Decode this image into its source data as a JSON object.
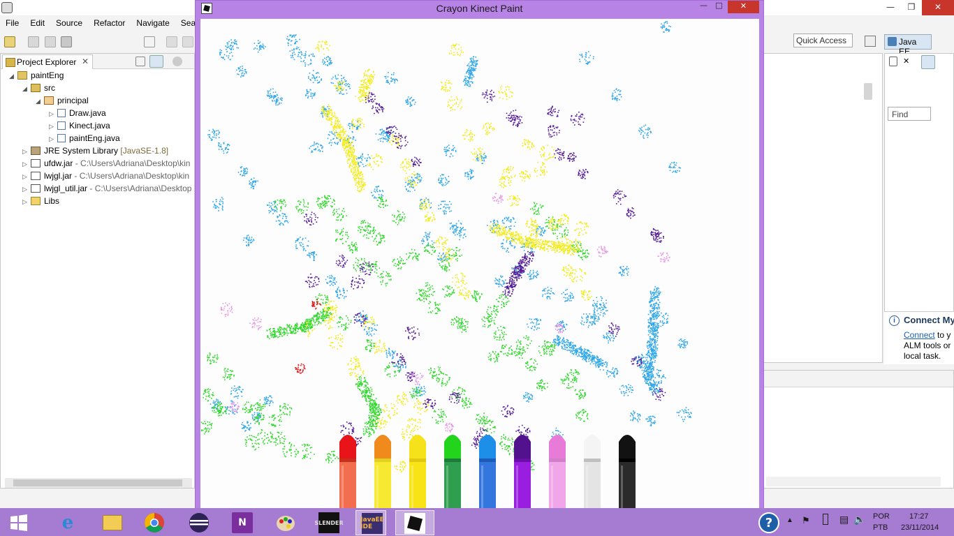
{
  "eclipse": {
    "menu": [
      "File",
      "Edit",
      "Source",
      "Refactor",
      "Navigate",
      "Search"
    ],
    "quick_access": "Quick Access",
    "perspective": "Java EE",
    "project_explorer": {
      "tab_label": "Project Explorer",
      "tab_close": "✕",
      "tree": [
        {
          "twisty": "◢",
          "icon": "proj",
          "label": "paintEng",
          "extra": ""
        },
        {
          "twisty": "◢",
          "icon": "pkgf",
          "label": "src",
          "extra": ""
        },
        {
          "twisty": "◢",
          "icon": "pkg",
          "label": "principal",
          "extra": ""
        },
        {
          "twisty": "▷",
          "icon": "java",
          "label": "Draw.java",
          "extra": ""
        },
        {
          "twisty": "▷",
          "icon": "java",
          "label": "Kinect.java",
          "extra": ""
        },
        {
          "twisty": "▷",
          "icon": "java",
          "label": "paintEng.java",
          "extra": ""
        },
        {
          "twisty": "▷",
          "icon": "lib",
          "label": "JRE System Library",
          "extra": "[JavaSE-1.8]"
        },
        {
          "twisty": "▷",
          "icon": "jar",
          "label": "ufdw.jar",
          "extra": "- C:\\Users\\Adriana\\Desktop\\kin"
        },
        {
          "twisty": "▷",
          "icon": "jar",
          "label": "lwjgl.jar",
          "extra": "- C:\\Users\\Adriana\\Desktop\\kin"
        },
        {
          "twisty": "▷",
          "icon": "jar",
          "label": "lwjgl_util.jar",
          "extra": "- C:\\Users\\Adriana\\Desktop"
        },
        {
          "twisty": "▷",
          "icon": "fold",
          "label": "Libs",
          "extra": ""
        }
      ]
    },
    "outline": {
      "find_placeholder": "Find"
    },
    "connect": {
      "title": "Connect My",
      "link": "Connect",
      "line1_rest": " to y",
      "line2": "ALM tools or",
      "line3": "local task."
    }
  },
  "paint": {
    "title": "Crayon Kinect Paint",
    "crayons": [
      {
        "name": "red",
        "tip": "#e8141a",
        "body": "#f26e4e",
        "band": "#c8301e"
      },
      {
        "name": "orange",
        "tip": "#f08a1c",
        "body": "#f7e832",
        "band": "#e0d020"
      },
      {
        "name": "yellow",
        "tip": "#f5e21a",
        "body": "#f7e316",
        "band": "#e0c810"
      },
      {
        "name": "green",
        "tip": "#22d41c",
        "body": "#2f9e4e",
        "band": "#1e7a3a"
      },
      {
        "name": "blue",
        "tip": "#1e8fe8",
        "body": "#3276de",
        "band": "#1e5ab8"
      },
      {
        "name": "purple",
        "tip": "#52128e",
        "body": "#9a1ee0",
        "band": "#6a10a8"
      },
      {
        "name": "pink",
        "tip": "#e87ad8",
        "body": "#f2a6ea",
        "band": "#d080c8"
      },
      {
        "name": "white",
        "tip": "#f4f4f4",
        "body": "#e4e4e4",
        "band": "#c0c0c0"
      },
      {
        "name": "black",
        "tip": "#121212",
        "body": "#2a2a2a",
        "band": "#000000"
      }
    ],
    "colors": {
      "blue": "#2fa6e8",
      "green": "#2ed82a",
      "yellow": "#f3ec1c",
      "purple": "#541a96",
      "pink": "#e79be6",
      "red": "#e01818"
    }
  },
  "taskbar": {
    "apps": [
      "windows-start",
      "internet-explorer",
      "file-explorer",
      "chrome",
      "eclipse",
      "onenote",
      "paint",
      "slender",
      "java-ee-ide",
      "crayon-kinect-paint"
    ],
    "help": "?",
    "lang_line1": "POR",
    "lang_line2": "PTB",
    "time": "17:27",
    "date": "23/11/2014"
  }
}
